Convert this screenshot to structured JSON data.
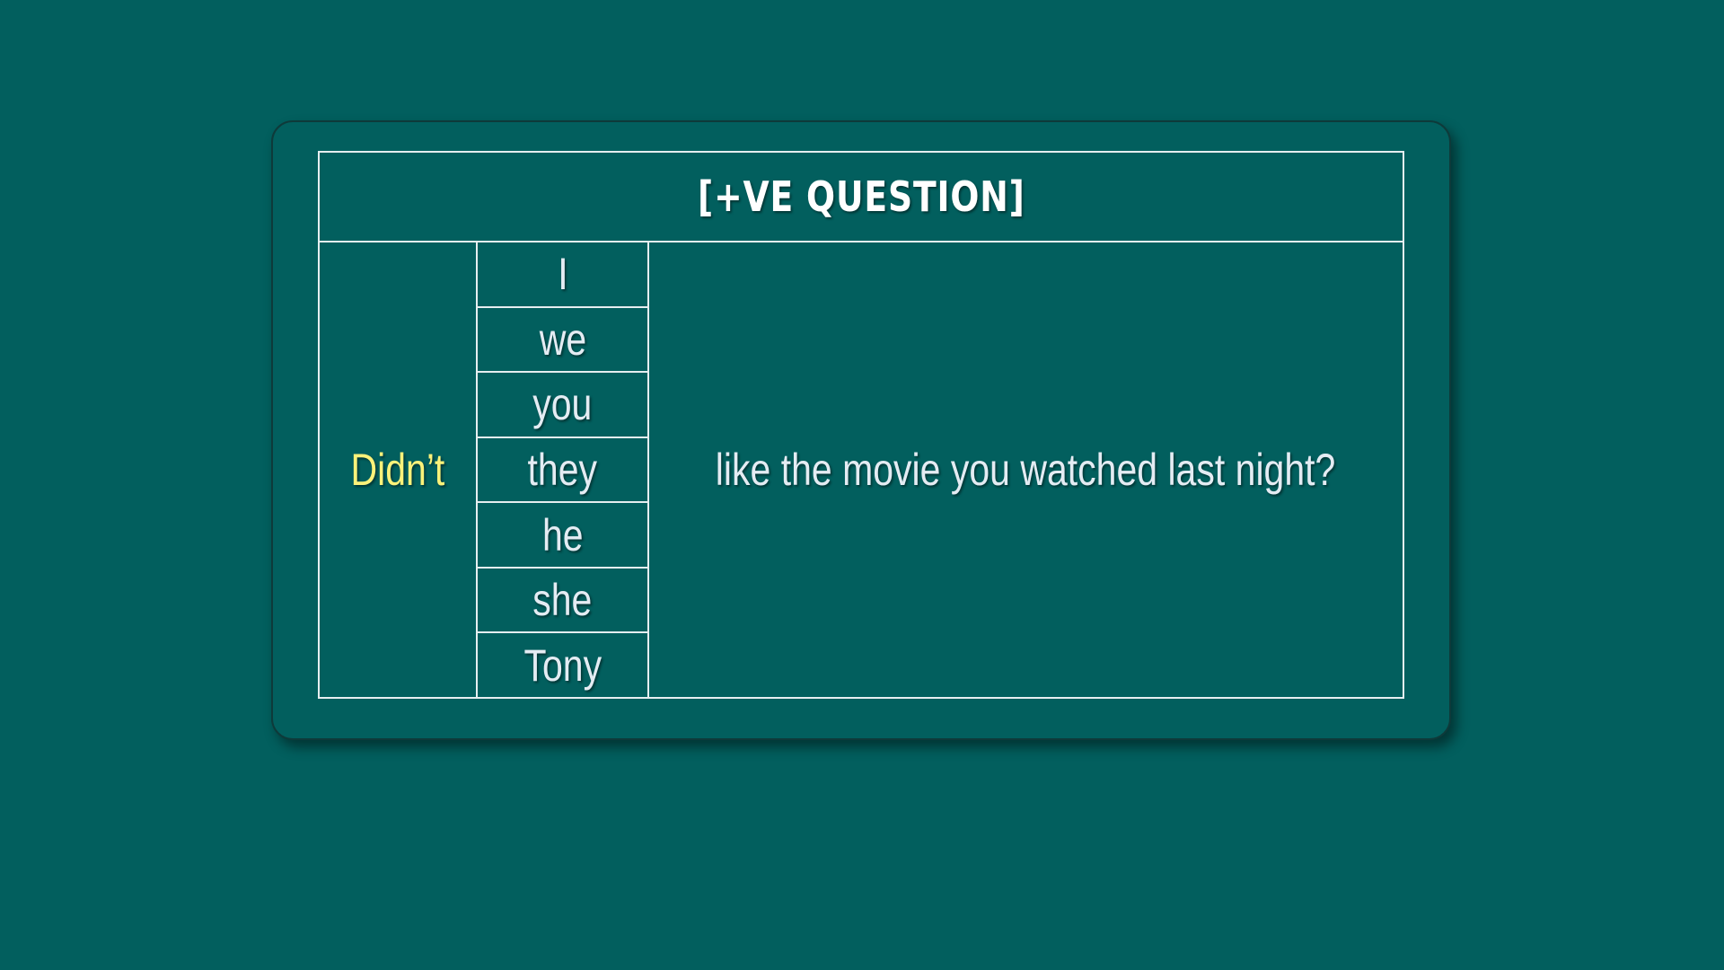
{
  "table": {
    "title": "[+VE QUESTION]",
    "auxiliary": "Didn’t",
    "subjects": [
      "I",
      "we",
      "you",
      "they",
      "he",
      "she",
      "Tony"
    ],
    "rest": "like the movie you watched last night?"
  },
  "colors": {
    "background": "#025f5e",
    "auxiliary_text": "#fbf27a",
    "body_text": "#e4ecf3",
    "title_text": "#ffffff",
    "border": "#e6eef0"
  }
}
